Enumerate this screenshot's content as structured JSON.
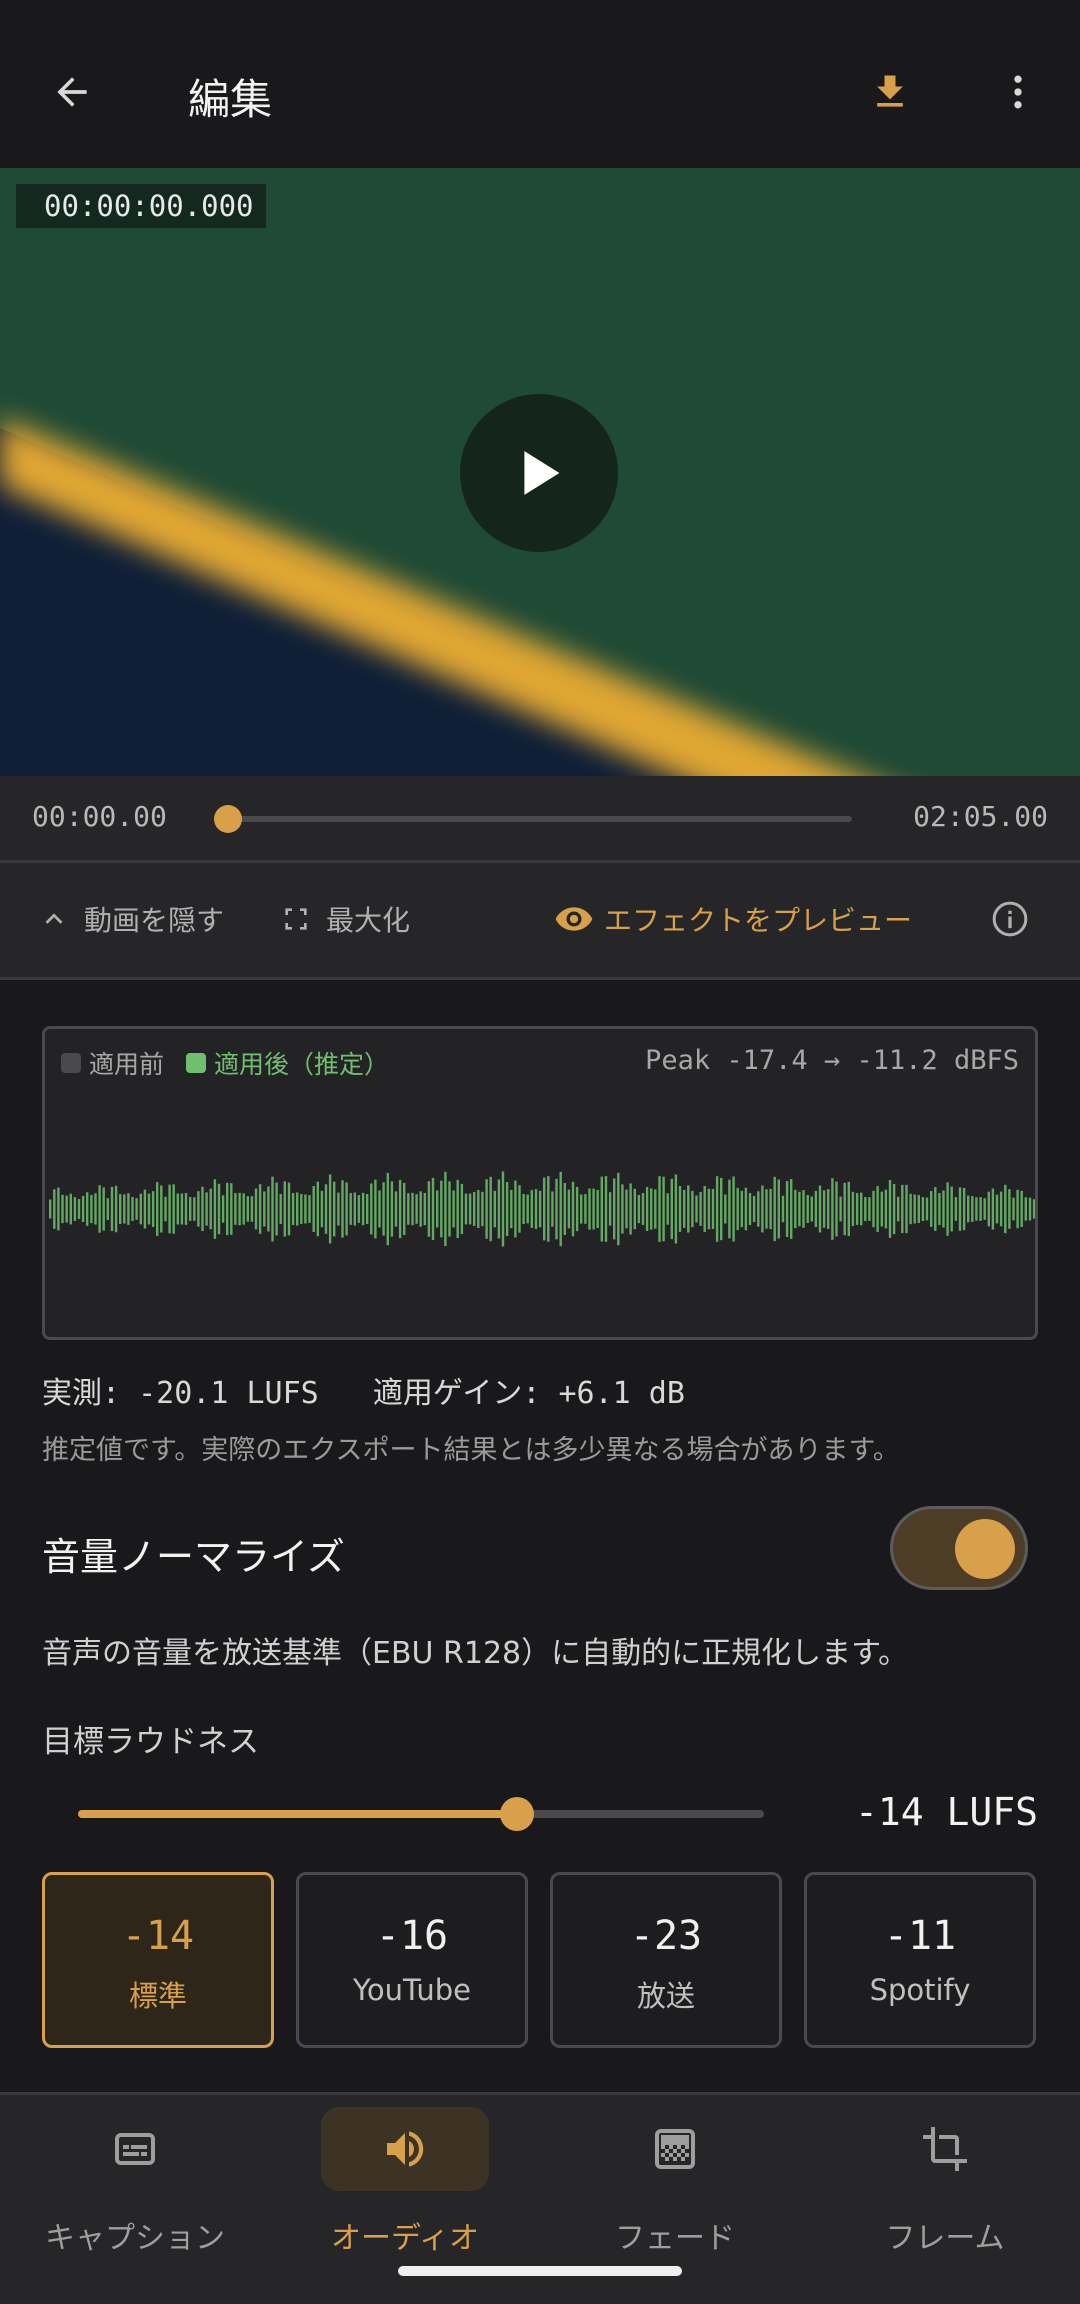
{
  "topbar": {
    "title": "編集"
  },
  "video": {
    "timecode": "00:00:00.000"
  },
  "scrub": {
    "current": "00:00.00",
    "total": "02:05.00",
    "progress": 0.0
  },
  "controls": {
    "hide_video": "動画を隠す",
    "maximize": "最大化",
    "preview_effect": "エフェクトをプレビュー"
  },
  "waveform": {
    "legend_before": "適用前",
    "legend_after": "適用後（推定）",
    "peak": "Peak -17.4 → -11.2 dBFS"
  },
  "measure": {
    "text": "実測: -20.1 LUFS   適用ゲイン: +6.1 dB"
  },
  "note": "推定値です。実際のエクスポート結果とは多少異なる場合があります。",
  "normalize": {
    "title": "音量ノーマライズ",
    "enabled": true,
    "description": "音声の音量を放送基準（EBU R128）に自動的に正規化します。"
  },
  "target": {
    "label": "目標ラウドネス",
    "value_text": "-14 LUFS",
    "level_fraction": 0.64
  },
  "presets": [
    {
      "value": "-14",
      "label": "標準",
      "active": true
    },
    {
      "value": "-16",
      "label": "YouTube",
      "active": false
    },
    {
      "value": "-23",
      "label": "放送",
      "active": false
    },
    {
      "value": "-11",
      "label": "Spotify",
      "active": false
    }
  ],
  "nav": [
    {
      "label": "キャプション",
      "icon": "caption-icon",
      "active": false
    },
    {
      "label": "オーディオ",
      "icon": "volume-icon",
      "active": true
    },
    {
      "label": "フェード",
      "icon": "fade-icon",
      "active": false
    },
    {
      "label": "フレーム",
      "icon": "crop-icon",
      "active": false
    }
  ],
  "colors": {
    "accent": "#d8a04a",
    "waveform_after": "#6fbf6f",
    "background": "#19191b"
  }
}
